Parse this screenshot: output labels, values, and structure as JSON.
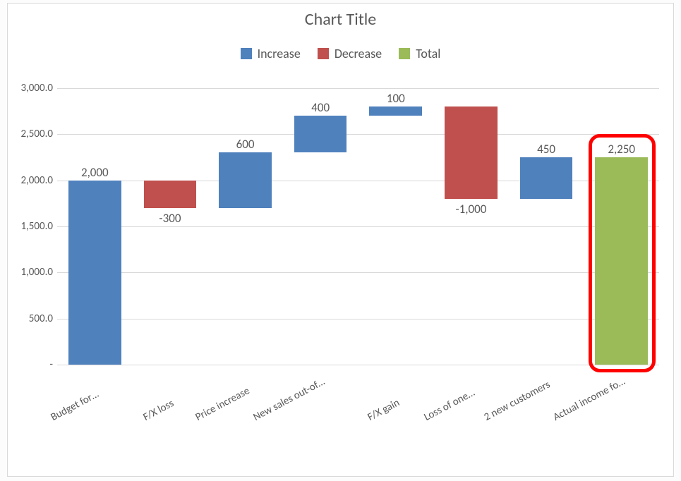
{
  "title": "Chart Title",
  "legend": {
    "increase": "Increase",
    "decrease": "Decrease",
    "total": "Total"
  },
  "y_axis": {
    "ticks": [
      0,
      500,
      1000,
      1500,
      2000,
      2500,
      3000
    ],
    "labels": [
      "-",
      "500.0",
      "1,000.0",
      "1,500.0",
      "2,000.0",
      "2,500.0",
      "3,000.0"
    ]
  },
  "colors": {
    "increase": "#4f81bd",
    "decrease": "#c0504d",
    "total": "#9bbb59"
  },
  "annotation": {
    "highlight_index": 7
  },
  "chart_data": {
    "type": "waterfall",
    "title": "Chart Title",
    "ylim": [
      0,
      3000
    ],
    "categories": [
      "Budget for…",
      "F/X loss",
      "Price increase",
      "New sales out-of…",
      "F/X gain",
      "Loss of one…",
      "2 new customers",
      "Actual income fo…"
    ],
    "values": [
      2000,
      -300,
      600,
      400,
      100,
      -1000,
      450,
      2250
    ],
    "data_labels": [
      "2,000",
      "-300",
      "600",
      "400",
      "100",
      "-1,000",
      "450",
      "2,250"
    ],
    "kinds": [
      "increase",
      "decrease",
      "increase",
      "increase",
      "increase",
      "decrease",
      "increase",
      "total"
    ],
    "cumulative_before": [
      0,
      2000,
      1700,
      2300,
      2700,
      2800,
      1800,
      0
    ],
    "cumulative_after": [
      2000,
      1700,
      2300,
      2700,
      2800,
      1800,
      2250,
      2250
    ],
    "label_position": [
      "above",
      "below",
      "above",
      "above",
      "above",
      "below",
      "above",
      "above"
    ]
  }
}
